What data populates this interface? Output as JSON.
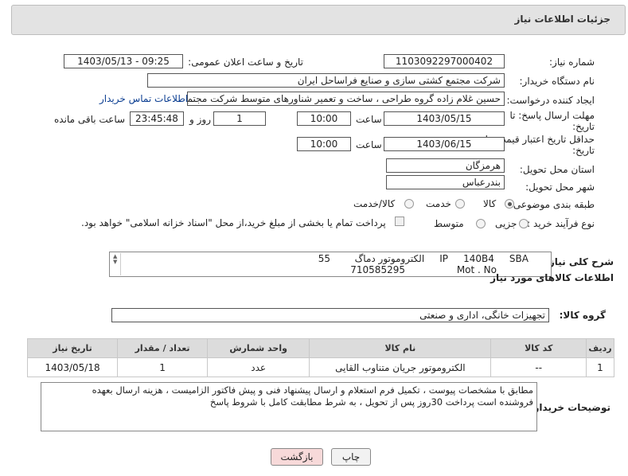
{
  "header": {
    "title": "جزئیات اطلاعات نیاز"
  },
  "fields": {
    "need_number_label": "شماره نیاز:",
    "need_number": "1103092297000402",
    "announce_label": "تاریخ و ساعت اعلان عمومی:",
    "announce_value": "1403/05/13 - 09:25",
    "buyer_label": "نام دستگاه خریدار:",
    "buyer_value": "شرکت مجتمع کشتی سازی و صنایع فراساحل ایران",
    "creator_label": "ایجاد کننده درخواست:",
    "creator_value": "حسین  غلام زاده گروه طراحی ، ساخت و تعمیر شناورهای متوسط شرکت مجتمع",
    "contact_link": "اطلاعات تماس خریدار",
    "deadline_label_1": "مهلت ارسال پاسخ: تا",
    "deadline_label_2": "تاریخ:",
    "deadline_date": "1403/05/15",
    "time_label": "ساعت",
    "deadline_time": "10:00",
    "days_value": "1",
    "days_label": "روز و",
    "remaining_value": "23:45:48",
    "remaining_label": "ساعت باقی مانده",
    "validity_label_1": "حداقل تاریخ اعتبار قیمت: تا",
    "validity_label_2": "تاریخ:",
    "validity_date": "1403/06/15",
    "validity_time": "10:00",
    "province_label": "استان محل تحویل:",
    "province_value": "هرمزگان",
    "city_label": "شهر محل تحویل:",
    "city_value": "بندرعباس",
    "category_label": "طبقه بندی موضوعی:",
    "cat_goods": "کالا",
    "cat_service": "خدمت",
    "cat_both": "کالا/خدمت",
    "process_label": "نوع فرآیند خرید :",
    "proc_partial": "جزیی",
    "proc_medium": "متوسط",
    "payment_note": "پرداخت تمام یا بخشی از مبلغ خرید،از محل \"اسناد خزانه اسلامی\" خواهد بود."
  },
  "description": {
    "label": "شرح کلی نیاز:",
    "line1": "الکتروموتور دماگ        55     IP     140B4     SBA",
    "line2": "710585295                 Mot . No"
  },
  "goods": {
    "section_title": "اطلاعات کالاهای مورد نیاز",
    "group_label": "گروه کالا:",
    "group_value": "تجهیزات خانگی، اداری و صنعتی",
    "columns": [
      "ردیف",
      "کد کالا",
      "نام کالا",
      "واحد شمارش",
      "تعداد / مقدار",
      "تاریخ نیاز"
    ],
    "rows": [
      {
        "index": "1",
        "code": "--",
        "name": "الکتروموتور جریان متناوب القایی",
        "unit": "عدد",
        "qty": "1",
        "date": "1403/05/18"
      }
    ]
  },
  "buyer_notes": {
    "label": "توضیحات خریدار:",
    "line1": "مطابق با مشخصات پیوست ، تکمیل فرم استعلام و ارسال پیشنهاد فنی و پیش فاکتور الزامیست ، هزینه ارسال بعهده",
    "line2": "فروشنده است پرداخت 30روز پس از تحویل ،  به شرط مطابقت کامل با شروط پاسخ"
  },
  "buttons": {
    "print": "چاپ",
    "back": "بازگشت"
  },
  "colors": {
    "back_button_bg": "#f7d9d9",
    "link": "#0a3d91"
  }
}
